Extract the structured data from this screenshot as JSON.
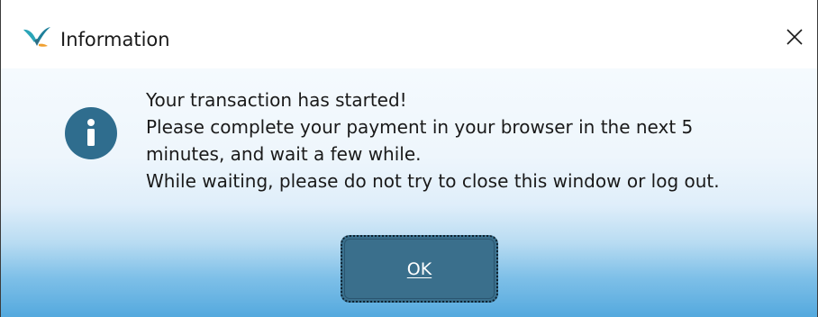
{
  "window": {
    "title": "Information",
    "app_icon": "bird-logo-icon",
    "close_icon": "close-icon"
  },
  "dialog": {
    "icon": "info-icon",
    "message_lines": [
      "Your transaction has started!",
      "Please complete your payment in your browser in the next 5",
      "minutes, and wait a few while.",
      "While waiting, please do not try to close this window or log out."
    ],
    "ok_label": "OK"
  },
  "colors": {
    "accent": "#3a6f8c",
    "info_icon_bg": "#2f6d8e",
    "gradient_bottom": "#54a9de"
  }
}
